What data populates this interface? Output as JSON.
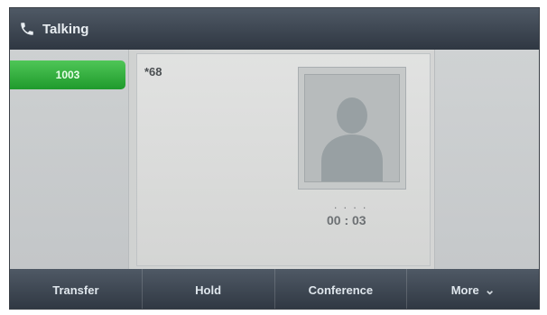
{
  "title_bar": {
    "icon": "phone-icon",
    "title": "Talking"
  },
  "line_key": {
    "label": "1003"
  },
  "call": {
    "number": "*68",
    "timer": "00 : 03",
    "avatar_icon": "person-silhouette-icon"
  },
  "softkeys": [
    {
      "label": "Transfer"
    },
    {
      "label": "Hold"
    },
    {
      "label": "Conference"
    },
    {
      "label": "More",
      "icon": "chevron-down-icon"
    }
  ],
  "colors": {
    "title_bg": "#3d4652",
    "accent_green": "#2aa33a"
  }
}
